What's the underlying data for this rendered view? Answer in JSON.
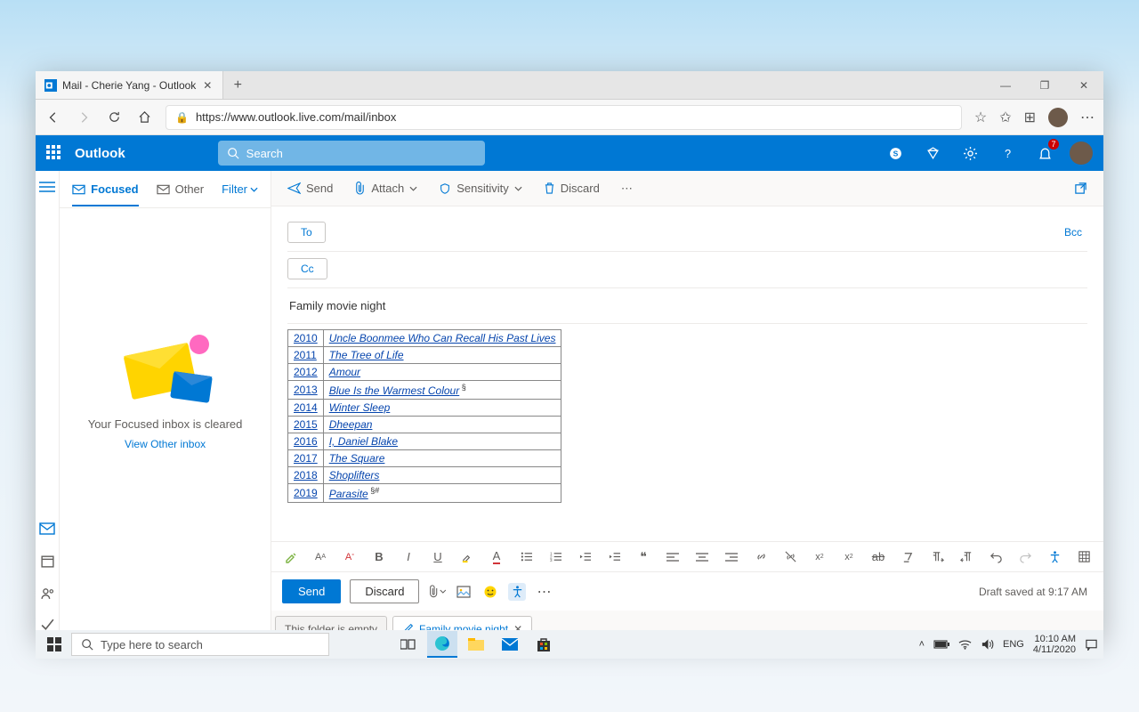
{
  "browser": {
    "tab_title": "Mail - Cherie Yang - Outlook",
    "url_display": "https://www.outlook.live.com/mail/inbox"
  },
  "header": {
    "brand": "Outlook",
    "search_placeholder": "Search",
    "bell_badge": "7"
  },
  "msglist": {
    "tab_focused": "Focused",
    "tab_other": "Other",
    "filter_label": "Filter",
    "empty_title": "Your Focused inbox is cleared",
    "empty_link": "View Other inbox"
  },
  "commandbar": {
    "send": "Send",
    "attach": "Attach",
    "sensitivity": "Sensitivity",
    "discard": "Discard"
  },
  "compose": {
    "to_label": "To",
    "cc_label": "Cc",
    "bcc_label": "Bcc",
    "subject": "Family movie night",
    "table_rows": [
      {
        "year": "2010",
        "title": "Uncle Boonmee Who Can Recall His Past Lives",
        "sup": ""
      },
      {
        "year": "2011",
        "title": "The Tree of Life",
        "sup": ""
      },
      {
        "year": "2012",
        "title": "Amour",
        "sup": ""
      },
      {
        "year": "2013",
        "title": "Blue Is the Warmest Colour",
        "sup": "§"
      },
      {
        "year": "2014",
        "title": "Winter Sleep",
        "sup": ""
      },
      {
        "year": "2015",
        "title": "Dheepan",
        "sup": ""
      },
      {
        "year": "2016",
        "title": "I, Daniel Blake",
        "sup": ""
      },
      {
        "year": "2017",
        "title": "The Square",
        "sup": ""
      },
      {
        "year": "2018",
        "title": "Shoplifters",
        "sup": ""
      },
      {
        "year": "2019",
        "title": "Parasite",
        "sup": "§#"
      }
    ]
  },
  "sendrow": {
    "send": "Send",
    "discard": "Discard",
    "draft_status": "Draft saved at 9:17 AM"
  },
  "bottom_tabs": {
    "inactive": "This folder is empty",
    "active": "Family movie night"
  },
  "taskbar": {
    "search_placeholder": "Type here to search",
    "time": "10:10 AM",
    "date": "4/11/2020"
  }
}
